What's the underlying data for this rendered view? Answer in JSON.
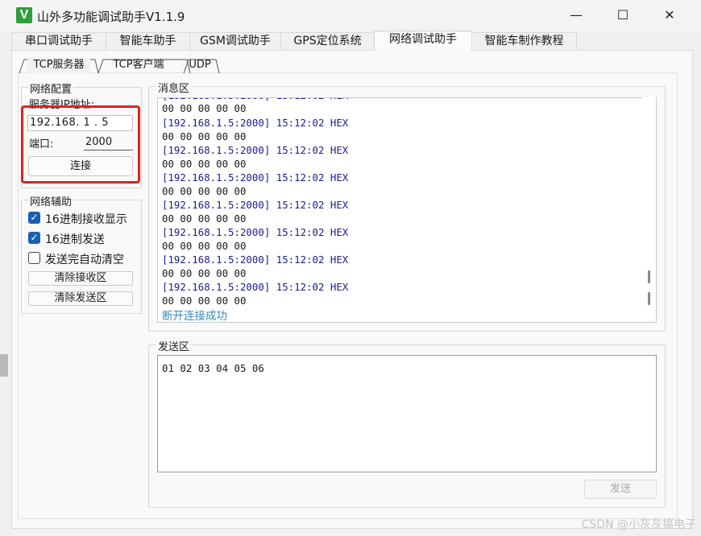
{
  "window": {
    "title": "山外多功能调试助手V1.1.9",
    "icon": "V",
    "accent": "#2e9e3b"
  },
  "window_controls": {
    "minimize": "—",
    "maximize": "☐",
    "close": "✕"
  },
  "main_tabs": [
    {
      "label": "串口调试助手"
    },
    {
      "label": "智能车助手"
    },
    {
      "label": "GSM调试助手"
    },
    {
      "label": "GPS定位系统"
    },
    {
      "label": "网络调试助手",
      "active": true
    },
    {
      "label": "智能车制作教程"
    }
  ],
  "sub_tabs": [
    {
      "label": "TCP服务器"
    },
    {
      "label": "TCP客户端",
      "active": true
    },
    {
      "label": "UDP"
    }
  ],
  "network_config": {
    "title": "网络配置",
    "ip_label": "服务器IP地址:",
    "ip_value": "192.168. 1 . 5",
    "port_label": "端口:",
    "port_value": "2000",
    "connect_label": "连接"
  },
  "network_aux": {
    "title": "网络辅助",
    "hex_receive": {
      "label": "16进制接收显示",
      "checked": true
    },
    "hex_send": {
      "label": "16进制发送",
      "checked": true
    },
    "auto_clear": {
      "label": "发送完自动清空",
      "checked": false
    },
    "clear_receive_label": "清除接收区",
    "clear_send_label": "清除发送区"
  },
  "message_area": {
    "title": "消息区",
    "top_partial": "00 00 00 00 00",
    "entries": [
      {
        "header": "[192.168.1.5:2000] 15:12:02 HEX",
        "data": "00 00 00 00 00"
      },
      {
        "header": "[192.168.1.5:2000] 15:12:02 HEX",
        "data": "00 00 00 00 00"
      },
      {
        "header": "[192.168.1.5:2000] 15:12:02 HEX",
        "data": "00 00 00 00 00"
      },
      {
        "header": "[192.168.1.5:2000] 15:12:02 HEX",
        "data": "00 00 00 00 00"
      },
      {
        "header": "[192.168.1.5:2000] 15:12:02 HEX",
        "data": "00 00 00 00 00"
      },
      {
        "header": "[192.168.1.5:2000] 15:12:02 HEX",
        "data": "00 00 00 00 00"
      },
      {
        "header": "[192.168.1.5:2000] 15:12:02 HEX",
        "data": "00 00 00 00 00"
      }
    ],
    "status": "断开连接成功"
  },
  "send_area": {
    "title": "发送区",
    "content": "01 02 03 04 05 06",
    "send_label": "发送"
  },
  "watermark": "CSDN @小灰灰搞电子",
  "colors": {
    "highlight": "#e0241b",
    "log_header": "#1c1c8c",
    "status": "#3a8ab8",
    "checkbox": "#1a5fb4"
  }
}
